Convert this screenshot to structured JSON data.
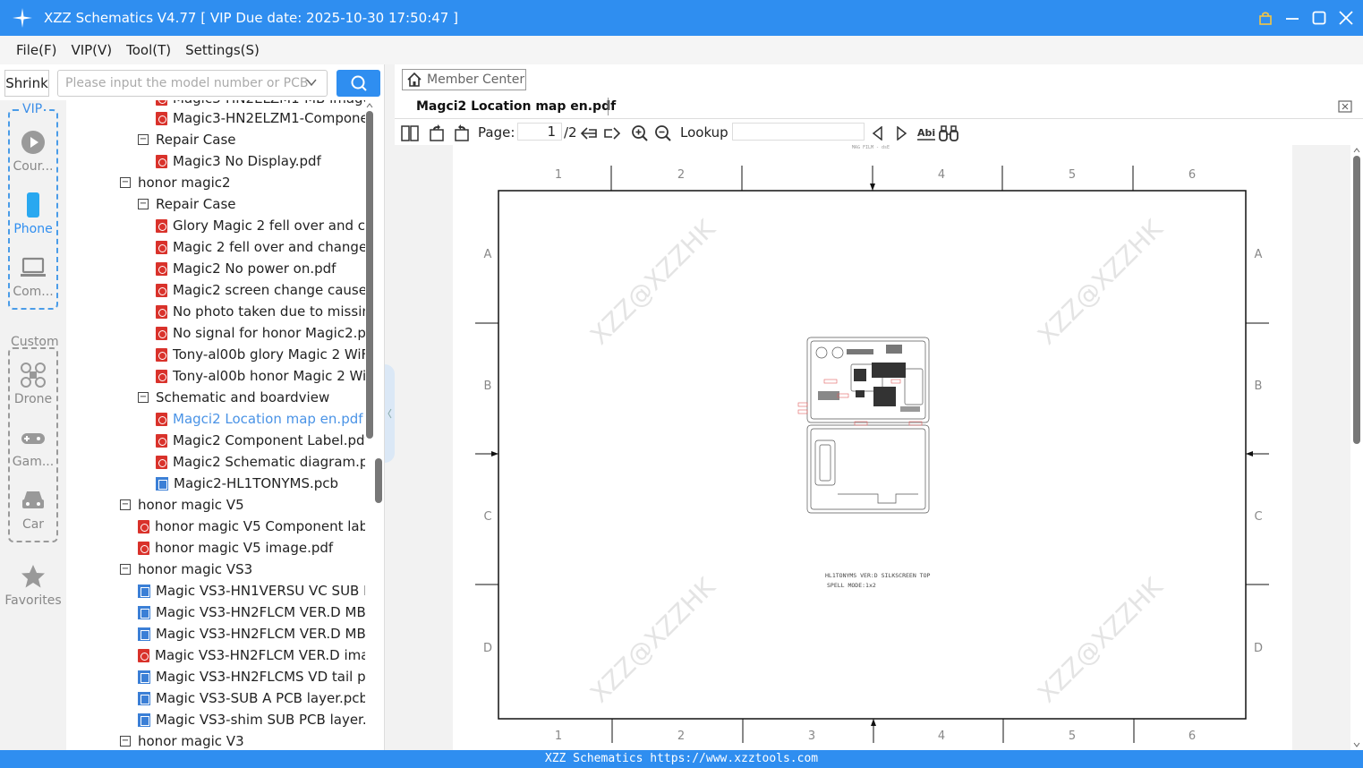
{
  "titlebar": {
    "title": "XZZ Schematics V4.77 [ VIP Due date: 2025-10-30 17:50:47 ]"
  },
  "menu": [
    "File(F)",
    "VIP(V)",
    "Tool(T)",
    "Settings(S)"
  ],
  "search": {
    "shrink_label": "Shrink",
    "placeholder": "Please input the model number or PCB"
  },
  "categories": {
    "vip_label": "VIP",
    "custom_label": "Custom",
    "items": [
      "Cour...",
      "Phone",
      "Com...",
      "Drone",
      "Gam...",
      "Car",
      "Favorites"
    ]
  },
  "tree": [
    {
      "label": "Magic3-HN2ELZM1-MB image.pdf",
      "type": "pdf"
    },
    {
      "label": "Magic3-HN2ELZM1-Component e",
      "type": "pdf"
    },
    {
      "label": "Repair Case",
      "type": "folder"
    },
    {
      "label": "Magic3 No Display.pdf",
      "type": "pdf"
    },
    {
      "label": "honor magic2",
      "type": "folder"
    },
    {
      "label": "Repair Case",
      "type": "folder"
    },
    {
      "label": "Glory Magic 2 fell over and char",
      "type": "pdf"
    },
    {
      "label": "Magic 2 fell over and changed t",
      "type": "pdf"
    },
    {
      "label": "Magic2 No power on.pdf",
      "type": "pdf"
    },
    {
      "label": "Magic2 screen change causes tl",
      "type": "pdf"
    },
    {
      "label": "No photo taken due to missing",
      "type": "pdf"
    },
    {
      "label": "No signal for honor Magic2.pdf",
      "type": "pdf"
    },
    {
      "label": "Tony-al00b glory Magic 2 WiFi c",
      "type": "pdf"
    },
    {
      "label": "Tony-al00b honor Magic 2 WiFi",
      "type": "pdf"
    },
    {
      "label": "Schematic and boardview",
      "type": "folder"
    },
    {
      "label": "Magci2 Location map en.pdf",
      "type": "pdf"
    },
    {
      "label": "Magic2 Component Label.pdf",
      "type": "pdf"
    },
    {
      "label": "Magic2 Schematic diagram.pdf",
      "type": "pdf"
    },
    {
      "label": "Magic2-HL1TONYMS.pcb",
      "type": "pcb"
    },
    {
      "label": "honor magic V5",
      "type": "folder"
    },
    {
      "label": "honor magic V5 Component labeli",
      "type": "pdf"
    },
    {
      "label": "honor magic V5 image.pdf",
      "type": "pdf"
    },
    {
      "label": "honor magic VS3",
      "type": "folder"
    },
    {
      "label": "Magic VS3-HN1VERSU VC SUB PCE",
      "type": "pcb"
    },
    {
      "label": "Magic VS3-HN2FLCM VER.D MB P(",
      "type": "pcb"
    },
    {
      "label": "Magic VS3-HN2FLCM VER.D MB+S",
      "type": "pcb"
    },
    {
      "label": "Magic VS3-HN2FLCM VER.D image",
      "type": "pdf"
    },
    {
      "label": "Magic VS3-HN2FLCMS VD tail plug",
      "type": "pcb"
    },
    {
      "label": "Magic VS3-SUB A PCB layer.pcb",
      "type": "pcb"
    },
    {
      "label": "Magic VS3-shim SUB PCB layer.pcb",
      "type": "pcb"
    },
    {
      "label": "honor magic V3",
      "type": "folder"
    }
  ],
  "viewer": {
    "member_center": "Member Center",
    "tab_title": "Magci2 Location map en.pdf",
    "page_label": "Page:",
    "page_current": "1",
    "page_total": "/2",
    "lookup_label": "Lookup",
    "lookup_value": ""
  },
  "drawing": {
    "top_label": "MAG FILM - dsE",
    "col_numbers_top": [
      "1",
      "2",
      "",
      "4",
      "5",
      "6"
    ],
    "col_numbers_bottom": [
      "1",
      "2",
      "3",
      "4",
      "5",
      "6"
    ],
    "row_letters": [
      "A",
      "B",
      "C",
      "D"
    ],
    "caption_line1": "HL1TONYMS VER:D SILKSCREEN TOP",
    "caption_line2": "SPELL MODE:1x2",
    "watermark": "XZZ@XZZHK"
  },
  "statusbar": {
    "text": "XZZ Schematics https://www.xzztools.com"
  },
  "colors": {
    "accent": "#2f8ef0",
    "pdf_icon": "#d9322b",
    "pcb_icon": "#3b7fd6",
    "selected_item": "#4a93e6"
  }
}
